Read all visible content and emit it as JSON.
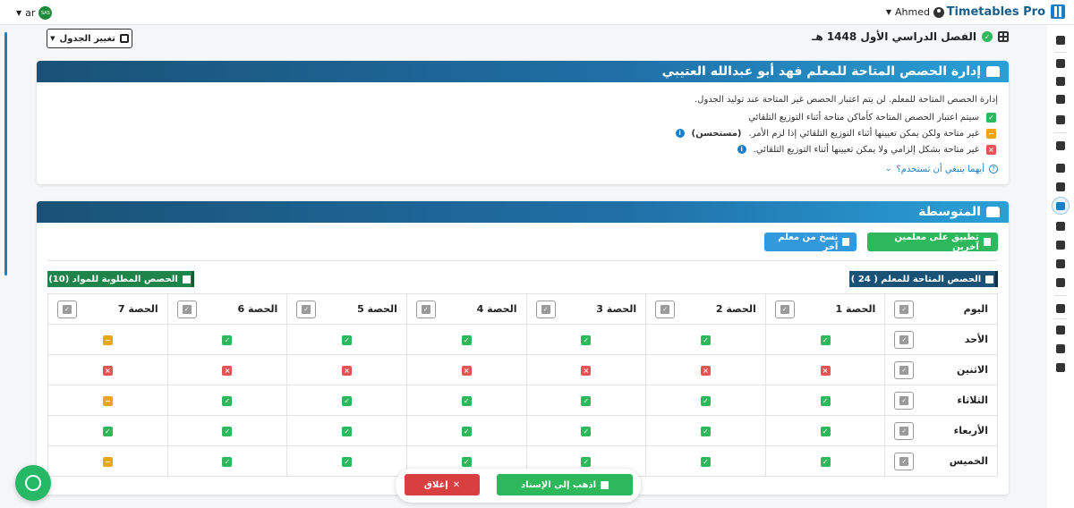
{
  "topbar": {
    "brand": "Timetables Pro",
    "brand_icon": "calendar-grid-icon",
    "user": "Ahmed",
    "lang": "ar",
    "flag_text": "SAS"
  },
  "semester": {
    "title": "الفصل الدراسي الأول 1448 هـ",
    "change_button": "تغيير الجدول"
  },
  "info_card": {
    "title": "إدارة الحصص المتاحة للمعلم فهد أبو عبدالله العتيبي",
    "intro": "إدارة الحصص المتاحة للمعلم. لن يتم اعتبار الحصص غير المتاحة عند توليد الجدول.",
    "legend": [
      {
        "status": "ok",
        "symbol": "✓",
        "text": "سيتم اعتبار الحصص المتاحة كأماكن متاحة أثناء التوزيع التلقائي"
      },
      {
        "status": "mid",
        "symbol": "−",
        "text": "غير متاحة ولكن يمكن تعيينها أثناء التوزيع التلقائي إذا لزم الأمر.",
        "bold": "(مستحسن)"
      },
      {
        "status": "no",
        "symbol": "×",
        "text": "غير متاحة بشكل إلزامي ولا يمكن تعيينها أثناء التوزيع التلقائي."
      }
    ],
    "which_link": "أيهما ينبغي أن تستخدم؟"
  },
  "schedule_card": {
    "title": "المتوسطة",
    "apply_button": "تطبيق على معلمين آخرين",
    "copy_button": "نسخ من معلم آخر",
    "available_badge": "الحصص المتاحة للمعلم ( 24 )",
    "required_badge": "الحصص المطلوبة للمواد (10)",
    "day_header": "اليوم",
    "periods": [
      "الحصة 1",
      "الحصة 2",
      "الحصة 3",
      "الحصة 4",
      "الحصة 5",
      "الحصة 6",
      "الحصة 7"
    ],
    "rows": [
      {
        "day": "الأحد",
        "cells": [
          "ok",
          "ok",
          "ok",
          "ok",
          "ok",
          "ok",
          "mid"
        ]
      },
      {
        "day": "الاثنين",
        "cells": [
          "no",
          "no",
          "no",
          "no",
          "no",
          "no",
          "no"
        ]
      },
      {
        "day": "الثلاثاء",
        "cells": [
          "ok",
          "ok",
          "ok",
          "ok",
          "ok",
          "ok",
          "mid"
        ]
      },
      {
        "day": "الأربعاء",
        "cells": [
          "ok",
          "ok",
          "ok",
          "ok",
          "ok",
          "ok",
          "ok"
        ]
      },
      {
        "day": "الخميس",
        "cells": [
          "ok",
          "ok",
          "ok",
          "ok",
          "ok",
          "ok",
          "mid"
        ]
      }
    ]
  },
  "footer": {
    "assign_button": "اذهب إلى الإسناد",
    "close_button": "إغلاق"
  },
  "colors": {
    "ok": "#2eb85c",
    "mid": "#f0a516",
    "no": "#e55353",
    "header": "#1a5276"
  }
}
